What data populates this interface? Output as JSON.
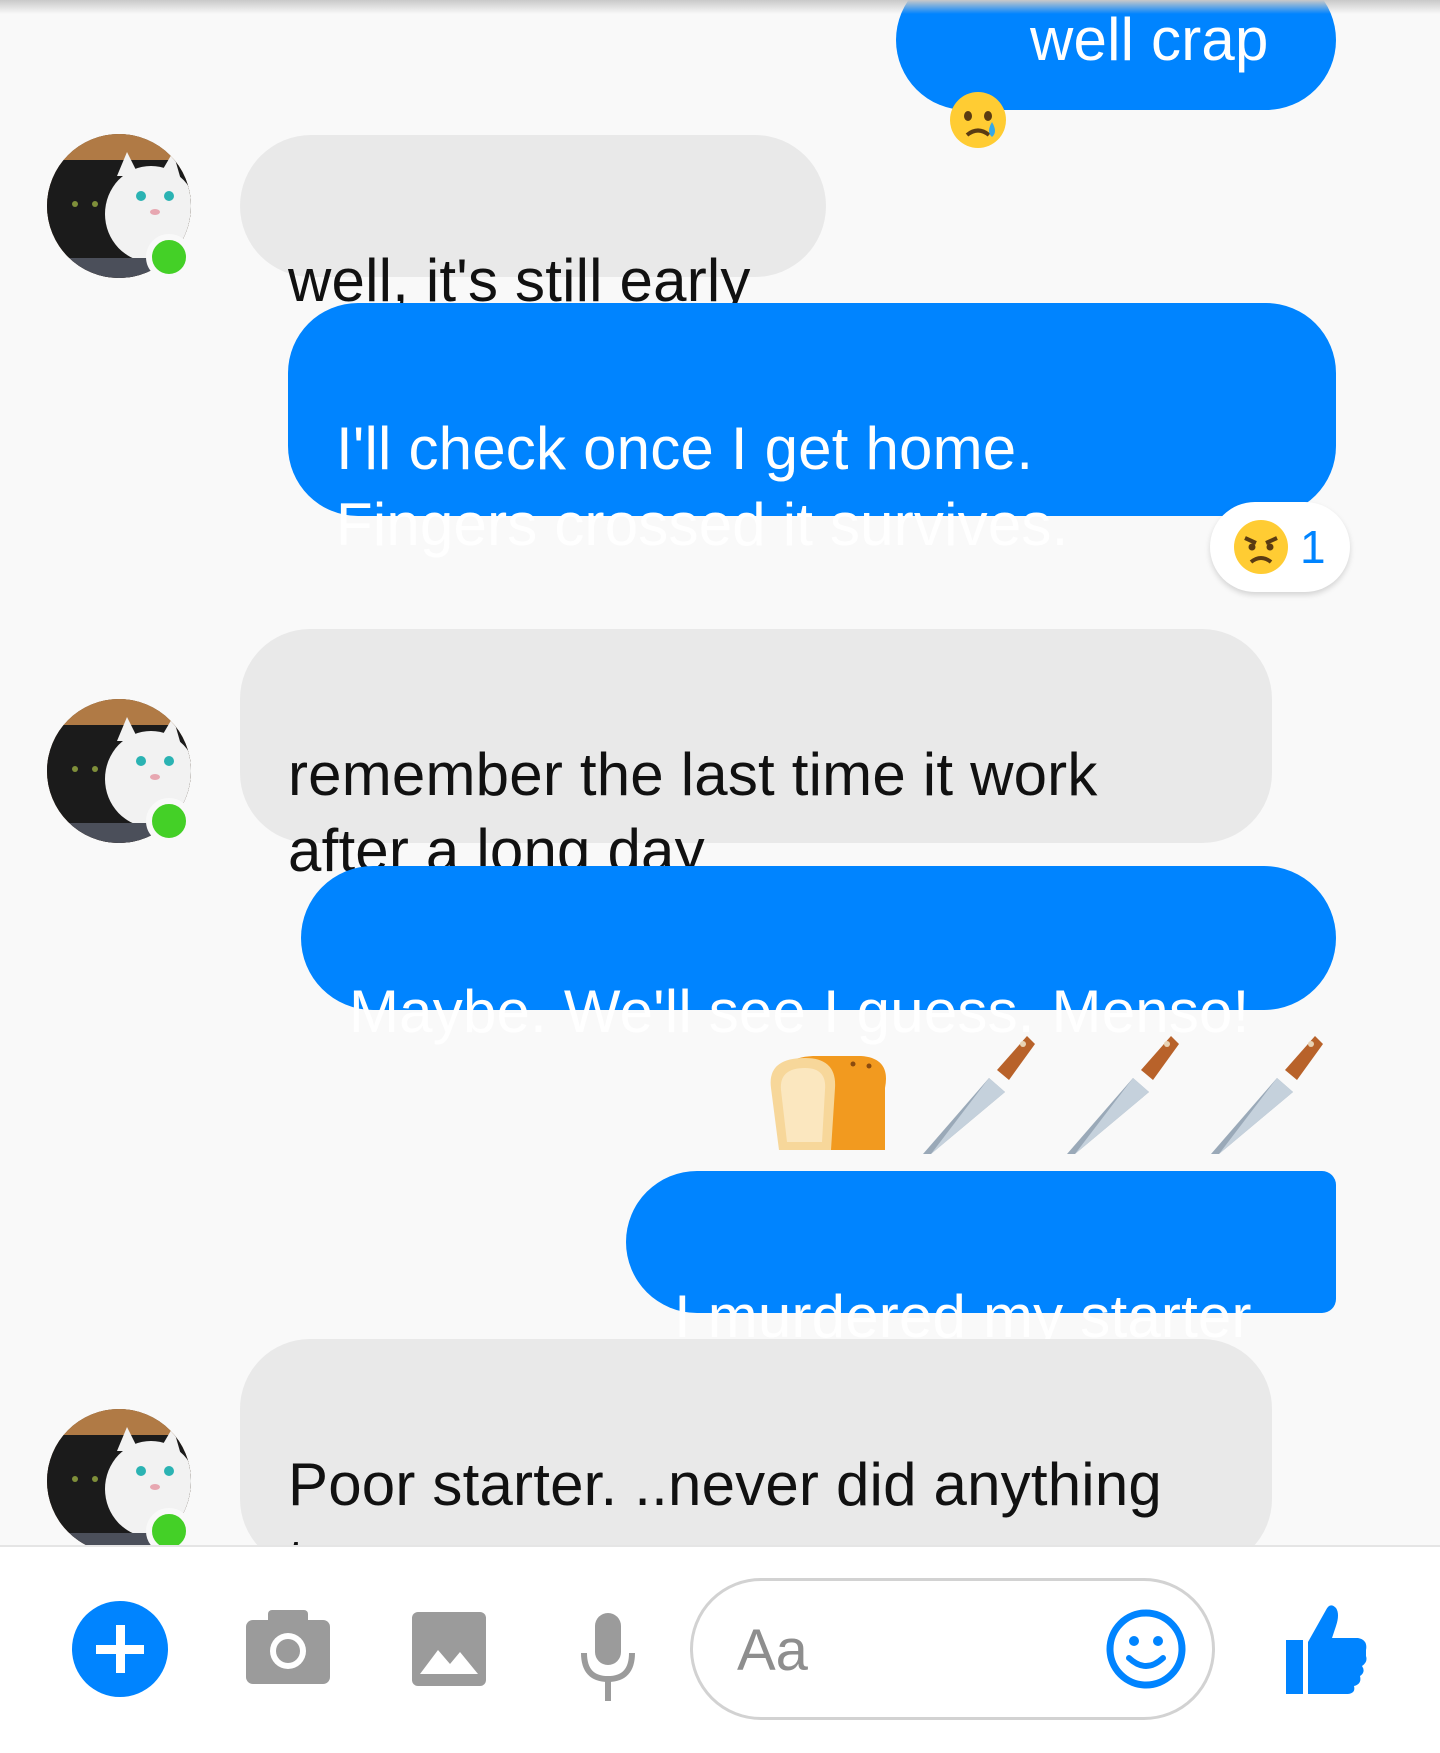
{
  "conversation": {
    "messages": [
      {
        "from": "me",
        "text": "well crap",
        "emoji_prefix": "crying-face"
      },
      {
        "from": "them",
        "text": "well, it's still early"
      },
      {
        "from": "me",
        "text": "I'll check once I get home.\nFingers crossed it survives.",
        "reaction": {
          "emoji": "angry-face",
          "count": "1"
        }
      },
      {
        "from": "them",
        "text": "remember the last time it work\nafter a long day"
      },
      {
        "from": "me",
        "text": "Maybe. We'll see I guess. Menso!"
      },
      {
        "from": "me",
        "type": "emoji",
        "emojis": [
          "bread",
          "kitchen-knife",
          "kitchen-knife",
          "kitchen-knife"
        ]
      },
      {
        "from": "me",
        "text": "I murdered my starter"
      },
      {
        "from": "them",
        "text": "Poor starter. ..never did anything\nto you"
      }
    ]
  },
  "composer": {
    "placeholder": "Aa",
    "buttons": [
      "plus-icon",
      "camera-icon",
      "gallery-icon",
      "microphone-icon",
      "smiley-icon",
      "thumbs-up-icon"
    ]
  },
  "colors": {
    "outgoing_bubble": "#0084ff",
    "incoming_bubble": "#e9e9e9",
    "online_dot": "#44d027",
    "accent": "#0084ff"
  }
}
